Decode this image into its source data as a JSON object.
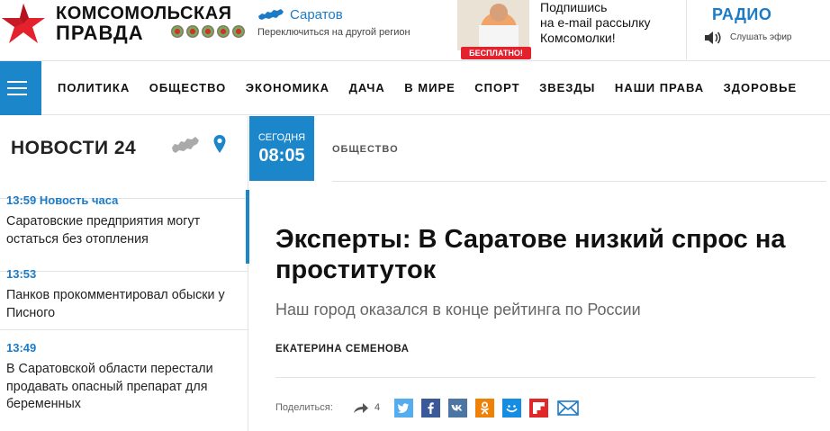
{
  "header": {
    "logo_line1": "КОМСОМОЛЬСКАЯ",
    "logo_line2": "ПРАВДА",
    "region_name": "Саратов",
    "region_switch": "Переключиться на другой регион",
    "promo_badge": "БЕСПЛАТНО!",
    "subscribe_line1": "Подпишись",
    "subscribe_line2": "на e-mail рассылку",
    "subscribe_line3": "Комсомолки!",
    "radio_title": "РАДИО",
    "radio_listen": "Слушать эфир"
  },
  "nav": {
    "items": [
      "ПОЛИТИКА",
      "ОБЩЕСТВО",
      "ЭКОНОМИКА",
      "ДАЧА",
      "В МИРЕ",
      "СПОРТ",
      "ЗВЕЗДЫ",
      "НАШИ ПРАВА",
      "ЗДОРОВЬЕ"
    ]
  },
  "sidebar": {
    "title": "НОВОСТИ 24",
    "news": [
      {
        "time": "13:59 Новость часа",
        "text": "Саратовские предприятия могут остаться без отопления"
      },
      {
        "time": "13:53",
        "text": "Панков прокомментировал обыски у Писного"
      },
      {
        "time": "13:49",
        "text": "В Саратовской области перестали продавать опасный препарат для беременных"
      }
    ]
  },
  "article": {
    "today_label": "СЕГОДНЯ",
    "today_time": "08:05",
    "category": "ОБЩЕСТВО",
    "headline": "Эксперты: В Саратове низкий спрос на проституток",
    "subtitle": "Наш город оказался в конце рейтинга по России",
    "author": "ЕКАТЕРИНА СЕМЕНОВА",
    "share_label": "Поделиться:",
    "share_count": "4"
  },
  "colors": {
    "accent": "#1b86c9",
    "link": "#1c7bc6",
    "promo_red": "#e4222e",
    "twitter": "#55acee",
    "facebook": "#3b5998",
    "vk": "#4c75a3",
    "odnoklassniki": "#ee8208",
    "mailru": "#168de2",
    "flipboard": "#e12828",
    "email": "#1c7bc6"
  }
}
